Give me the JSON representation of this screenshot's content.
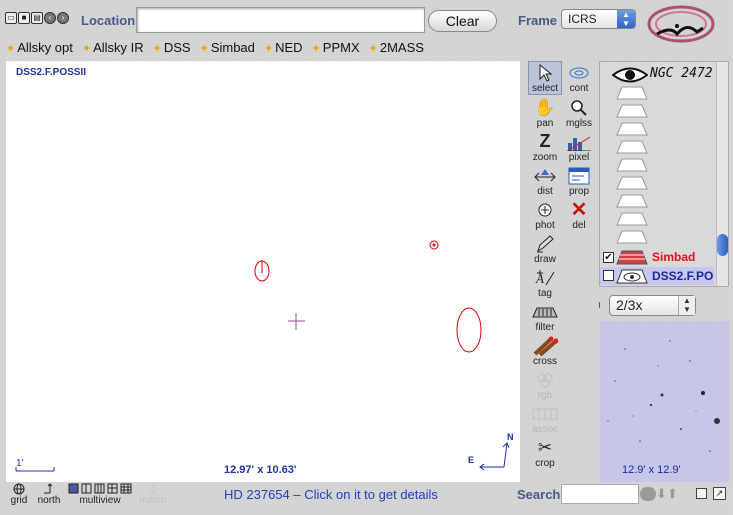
{
  "toolbar": {
    "location_label": "Location",
    "location_value": "",
    "clear_label": "Clear",
    "frame_label": "Frame",
    "frame_value": "ICRS"
  },
  "servers": [
    "Allsky opt",
    "Allsky IR",
    "DSS",
    "Simbad",
    "NED",
    "PPMX",
    "2MASS"
  ],
  "view": {
    "survey_label": "DSS2.F.POSSII",
    "scale_label": "1'",
    "fov_label": "12.97' x 10.63'",
    "compass_north": "N",
    "compass_east": "E"
  },
  "tools": {
    "select": "select",
    "cont": "cont",
    "pan": "pan",
    "mglss": "mglss",
    "zoom": "zoom",
    "pixel": "pixel",
    "dist": "dist",
    "prop": "prop",
    "phot": "phot",
    "del": "del",
    "draw": "draw",
    "tag": "tag",
    "filter": "filter",
    "cross": "cross",
    "rgb": "rgb",
    "assoc": "assoc",
    "crop": "crop"
  },
  "stack": {
    "ngc_label": "NGC 2472",
    "simbad_label": "Simbad",
    "dss_label": "DSS2.F.PO",
    "simbad_checked": true,
    "dss_checked": false
  },
  "zoom_value": "2/3x",
  "thumb_label": "12.9' x 12.9'",
  "bottom": {
    "grid": "grid",
    "north": "north",
    "multiview": "multiview",
    "match": "match",
    "status": "HD 237654 – Click on it to get details",
    "search_label": "Search",
    "search_value": ""
  },
  "colors": {
    "accent_label": "#4a5a86",
    "status_blue": "#1f3fbf",
    "simbad_red": "#e0101a",
    "marker_red": "#d80000"
  }
}
